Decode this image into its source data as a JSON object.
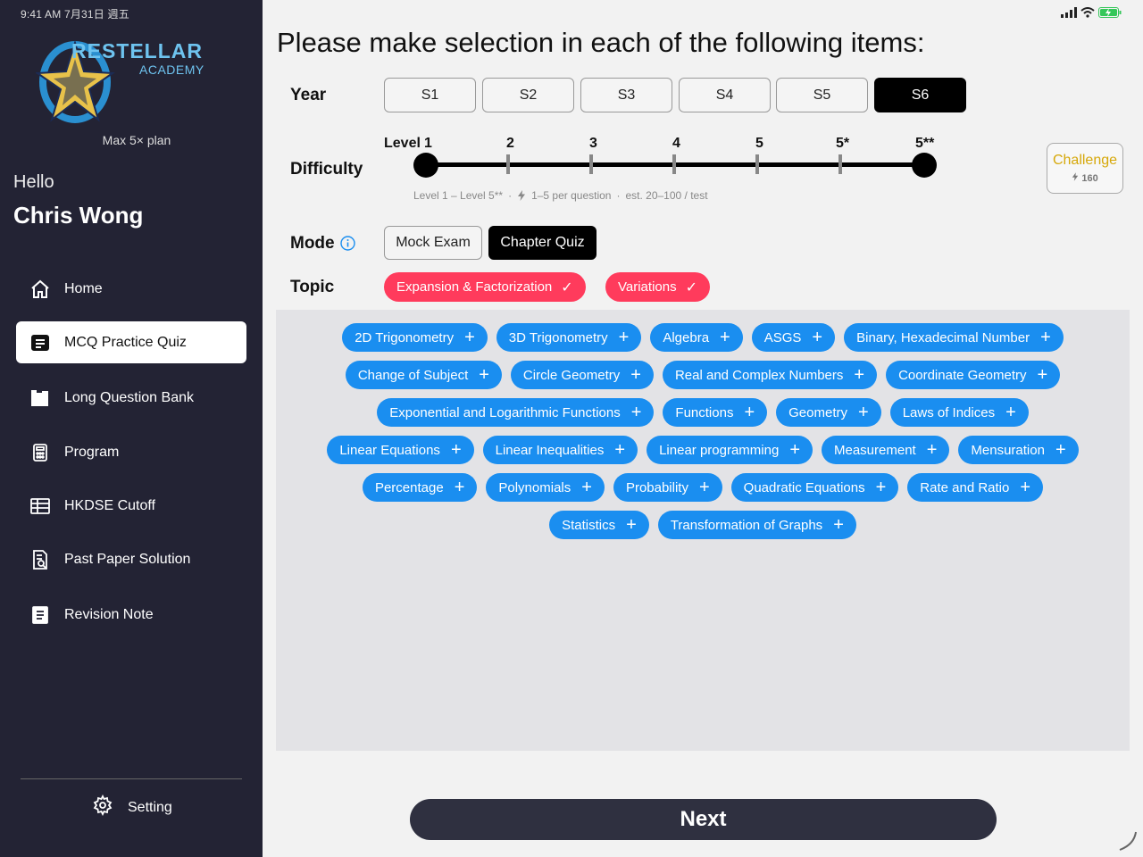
{
  "status_bar": {
    "time": "9:41 AM  7月31日 週五"
  },
  "sidebar": {
    "logo": {
      "text": "RESTELLAR",
      "sub": "ACADEMY"
    },
    "plan": "Max 5× plan",
    "greeting": "Hello",
    "user_name": "Chris Wong",
    "nav": [
      {
        "label": "Home",
        "icon": "home-icon",
        "active": false
      },
      {
        "label": "MCQ Practice Quiz",
        "icon": "quiz-icon",
        "active": true
      },
      {
        "label": "Long Question Bank",
        "icon": "books-icon",
        "active": false
      },
      {
        "label": "Program",
        "icon": "calculator-icon",
        "active": false
      },
      {
        "label": "HKDSE Cutoff",
        "icon": "table-icon",
        "active": false
      },
      {
        "label": "Past Paper Solution",
        "icon": "document-search-icon",
        "active": false
      },
      {
        "label": "Revision Note",
        "icon": "notebook-icon",
        "active": false
      }
    ],
    "setting_label": "Setting"
  },
  "main": {
    "title": "Please make selection in each of the following items:",
    "year": {
      "label": "Year",
      "options": [
        "S1",
        "S2",
        "S3",
        "S4",
        "S5",
        "S6"
      ],
      "selected": "S6"
    },
    "difficulty": {
      "label": "Difficulty",
      "level_prefix": "Level",
      "levels": [
        "1",
        "2",
        "3",
        "4",
        "5",
        "5*",
        "5**"
      ],
      "range": [
        "1",
        "5**"
      ],
      "note_range": "Level 1 – Level 5**",
      "note_per_question": "1–5 per question",
      "note_estimate": "est. 20–100 / test"
    },
    "challenge": {
      "label": "Challenge",
      "cost": "160"
    },
    "mode": {
      "label": "Mode",
      "options": [
        "Mock Exam",
        "Chapter Quiz"
      ],
      "selected": "Chapter Quiz"
    },
    "topic": {
      "label": "Topic",
      "selected": [
        "Expansion & Factorization",
        "Variations"
      ],
      "available_rows": [
        [
          "2D Trigonometry",
          "3D Trigonometry",
          "Algebra",
          "ASGS",
          "Binary, Hexadecimal Number"
        ],
        [
          "Change of Subject",
          "Circle Geometry",
          "Real and Complex Numbers",
          "Coordinate Geometry"
        ],
        [
          "Exponential and Logarithmic Functions",
          "Functions",
          "Geometry",
          "Laws of Indices"
        ],
        [
          "Linear Equations",
          "Linear Inequalities",
          "Linear programming",
          "Measurement",
          "Mensuration"
        ],
        [
          "Percentage",
          "Polynomials",
          "Probability",
          "Quadratic Equations",
          "Rate and Ratio"
        ],
        [
          "Statistics",
          "Transformation of Graphs"
        ]
      ]
    },
    "next_label": "Next"
  },
  "colors": {
    "sidebar_bg": "#232334",
    "selected_topic": "#ff3b5c",
    "topic_chip": "#1a8ef0",
    "challenge": "#d6a80a"
  }
}
